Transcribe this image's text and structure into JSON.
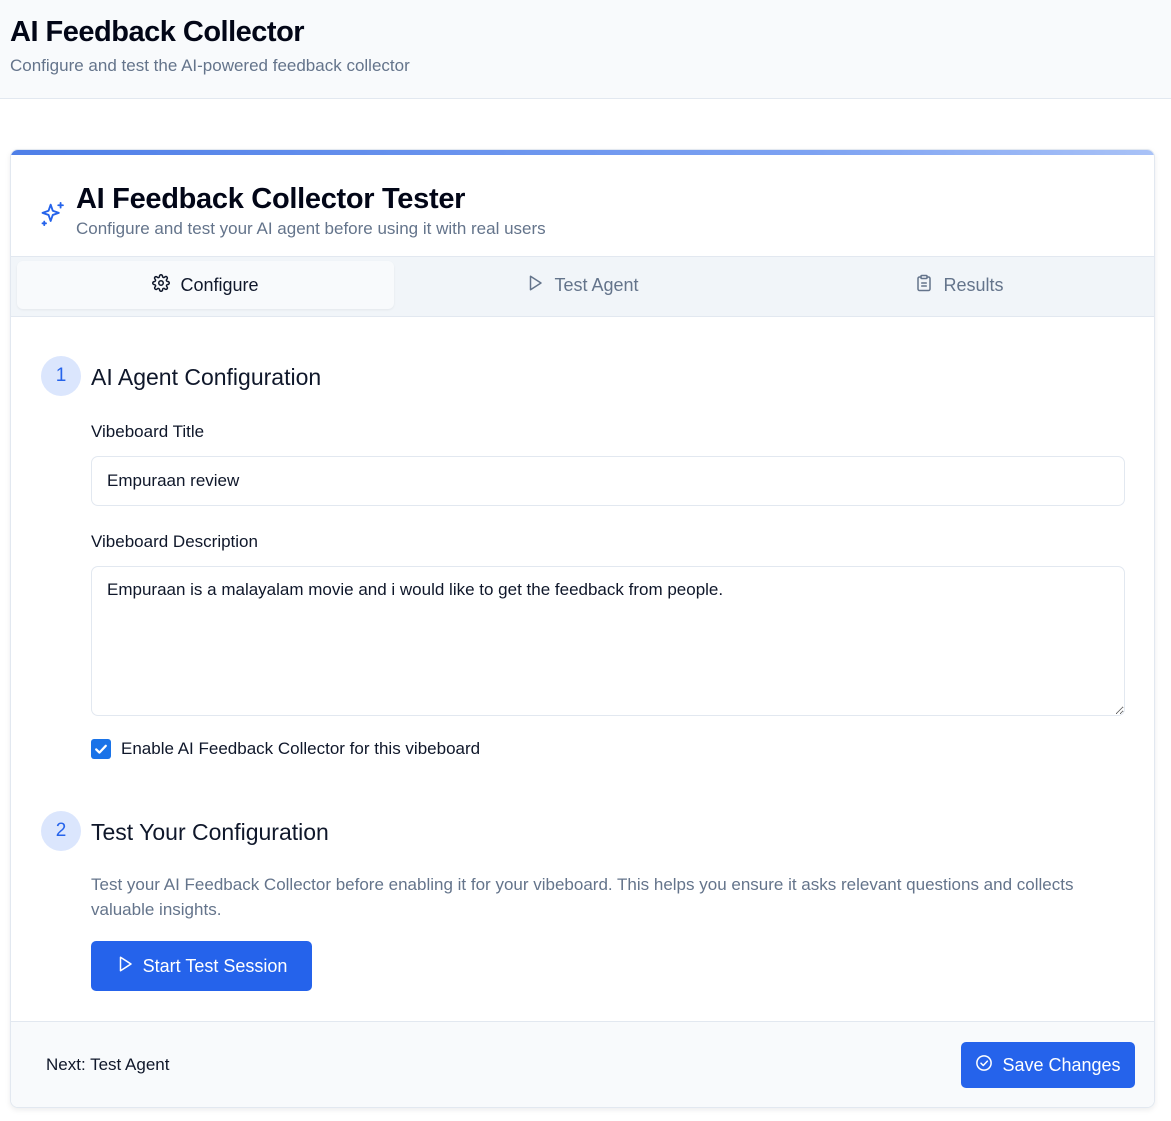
{
  "header": {
    "title": "AI Feedback Collector",
    "subtitle": "Configure and test the AI-powered feedback collector"
  },
  "card": {
    "icon": "sparkles-icon",
    "title": "AI Feedback Collector Tester",
    "subtitle": "Configure and test your AI agent before using it with real users"
  },
  "tabs": [
    {
      "label": "Configure",
      "icon": "gear-icon",
      "active": true
    },
    {
      "label": "Test Agent",
      "icon": "play-icon",
      "active": false
    },
    {
      "label": "Results",
      "icon": "clipboard-icon",
      "active": false
    }
  ],
  "step1": {
    "number": "1",
    "title": "AI Agent Configuration",
    "title_label": "Vibeboard Title",
    "title_value": "Empuraan review",
    "description_label": "Vibeboard Description",
    "description_value": "Empuraan is a malayalam movie and i would like to get the feedback from people.",
    "enable_label": "Enable AI Feedback Collector for this vibeboard",
    "enable_checked": true
  },
  "step2": {
    "number": "2",
    "title": "Test Your Configuration",
    "help_text": "Test your AI Feedback Collector before enabling it for your vibeboard. This helps you ensure it asks relevant questions and collects valuable insights.",
    "start_button": "Start Test Session"
  },
  "footer": {
    "next_label": "Next: Test Agent",
    "save_button": "Save Changes"
  },
  "colors": {
    "accent": "#2563eb",
    "badge_bg": "#dbe6fd",
    "muted_text": "#64748b"
  }
}
